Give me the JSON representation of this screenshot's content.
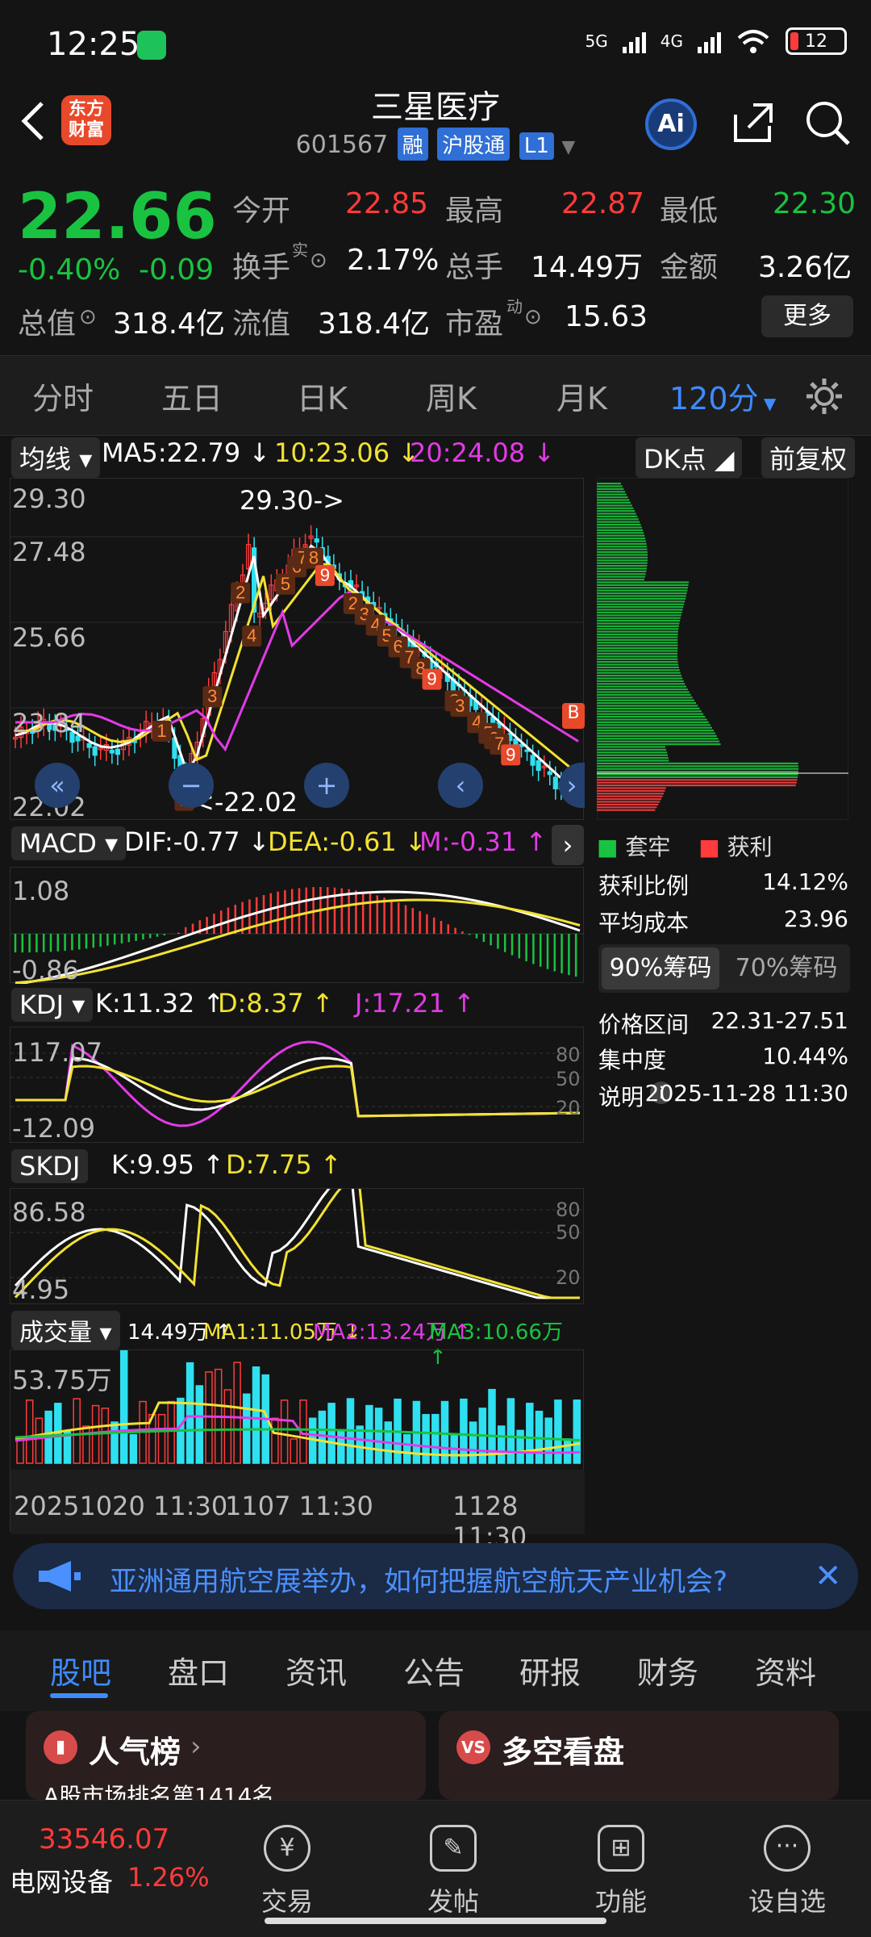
{
  "status_bar": {
    "time": "12:25",
    "network": "5G",
    "network2": "4G",
    "battery": "12"
  },
  "header": {
    "app_logo": "东方财富",
    "stock_name": "三星医疗",
    "stock_code": "601567",
    "tags": [
      "融",
      "沪股通",
      "L1"
    ],
    "ai_label": "Ai"
  },
  "quote": {
    "price": "22.66",
    "change_pct": "-0.40%",
    "change": "-0.09",
    "open_label": "今开",
    "open": "22.85",
    "high_label": "最高",
    "high": "22.87",
    "low_label": "最低",
    "low": "22.30",
    "turnover_label": "换手",
    "turnover_sup": "实",
    "turnover": "2.17%",
    "volume_label": "总手",
    "volume": "14.49万",
    "amount_label": "金额",
    "amount": "3.26亿",
    "mktcap_label": "总值",
    "mktcap": "318.4亿",
    "float_label": "流值",
    "float": "318.4亿",
    "pe_label": "市盈",
    "pe_sup": "动",
    "pe": "15.63",
    "more_label": "更多"
  },
  "period_tabs": [
    {
      "label": "分时"
    },
    {
      "label": "五日"
    },
    {
      "label": "日K"
    },
    {
      "label": "周K"
    },
    {
      "label": "月K"
    },
    {
      "label": "120分",
      "active": true
    }
  ],
  "ma_legend": {
    "selector": "均线",
    "ma5": "MA5:22.79 ↓",
    "ma10": "10:23.06 ↓",
    "ma20": "20:24.08 ↓",
    "dk": "DK点",
    "fq": "前复权"
  },
  "kline_axis": {
    "y_top": "29.30",
    "y_2": "27.48",
    "y_3": "25.66",
    "y_4": "23.84",
    "y_bottom": "22.02",
    "hi_note": "29.30->",
    "lo_note": "<-22.02",
    "b_marker": "B"
  },
  "td_labels": [
    "2",
    "4",
    "5",
    "6",
    "7",
    "8",
    "9",
    "1",
    "3",
    "1",
    "2",
    "3",
    "4",
    "5",
    "6",
    "7",
    "8",
    "9",
    "2",
    "3",
    "4",
    "5",
    "6",
    "7",
    "9"
  ],
  "macd": {
    "selector": "MACD",
    "dif": "DIF:-0.77 ↓",
    "dea": "DEA:-0.61 ↓",
    "m": "M:-0.31 ↑",
    "y_top": "1.08",
    "y_bottom": "-0.86"
  },
  "kdj": {
    "selector": "KDJ",
    "k": "K:11.32 ↑",
    "d": "D:8.37 ↑",
    "j": "J:17.21 ↑",
    "y_top": "117.07",
    "y_bottom": "-12.09",
    "lv80": "80",
    "lv50": "50",
    "lv20": "20"
  },
  "skdj": {
    "selector": "SKDJ",
    "k": "K:9.95 ↑",
    "d": "D:7.75 ↑",
    "y_top": "86.58",
    "y_bottom": "4.95",
    "lv80": "80",
    "lv50": "50",
    "lv20": "20"
  },
  "volume": {
    "selector": "成交量",
    "vol": "14.49万 ↑",
    "ma1": "MA1:11.05万 ↓",
    "ma2": "MA2:13.24万 ↑",
    "ma3": "MA3:10.66万 ↑",
    "y_top": "53.75万"
  },
  "x_axis": {
    "start": "20251020 11:30",
    "mid": "1107 11:30",
    "end": "1128 11:30"
  },
  "chip": {
    "legend_trapped": "套牢",
    "legend_profit": "获利",
    "profit_ratio_label": "获利比例",
    "profit_ratio": "14.12%",
    "avg_cost_label": "平均成本",
    "avg_cost": "23.96",
    "tab90": "90%筹码",
    "tab70": "70%筹码",
    "range_label": "价格区间",
    "range": "22.31-27.51",
    "concentration_label": "集中度",
    "concentration": "10.44%",
    "note_label": "说明",
    "note_time": "2025-11-28 11:30"
  },
  "ad": {
    "text": "亚洲通用航空展举办，如何把握航空航天产业机会?"
  },
  "nav_tabs": [
    {
      "label": "股吧",
      "active": true
    },
    {
      "label": "盘口"
    },
    {
      "label": "资讯"
    },
    {
      "label": "公告"
    },
    {
      "label": "研报"
    },
    {
      "label": "财务"
    },
    {
      "label": "资料"
    }
  ],
  "cards": {
    "popular": "人气榜",
    "popular_sub": "A股市场排名第1414名",
    "bullbear": "多空看盘"
  },
  "bottom_bar": {
    "index_value": "33546.07",
    "index_name": "电网设备",
    "index_change": "1.26%",
    "trade": "交易",
    "post": "发帖",
    "functions": "功能",
    "watchlist": "设自选"
  }
}
